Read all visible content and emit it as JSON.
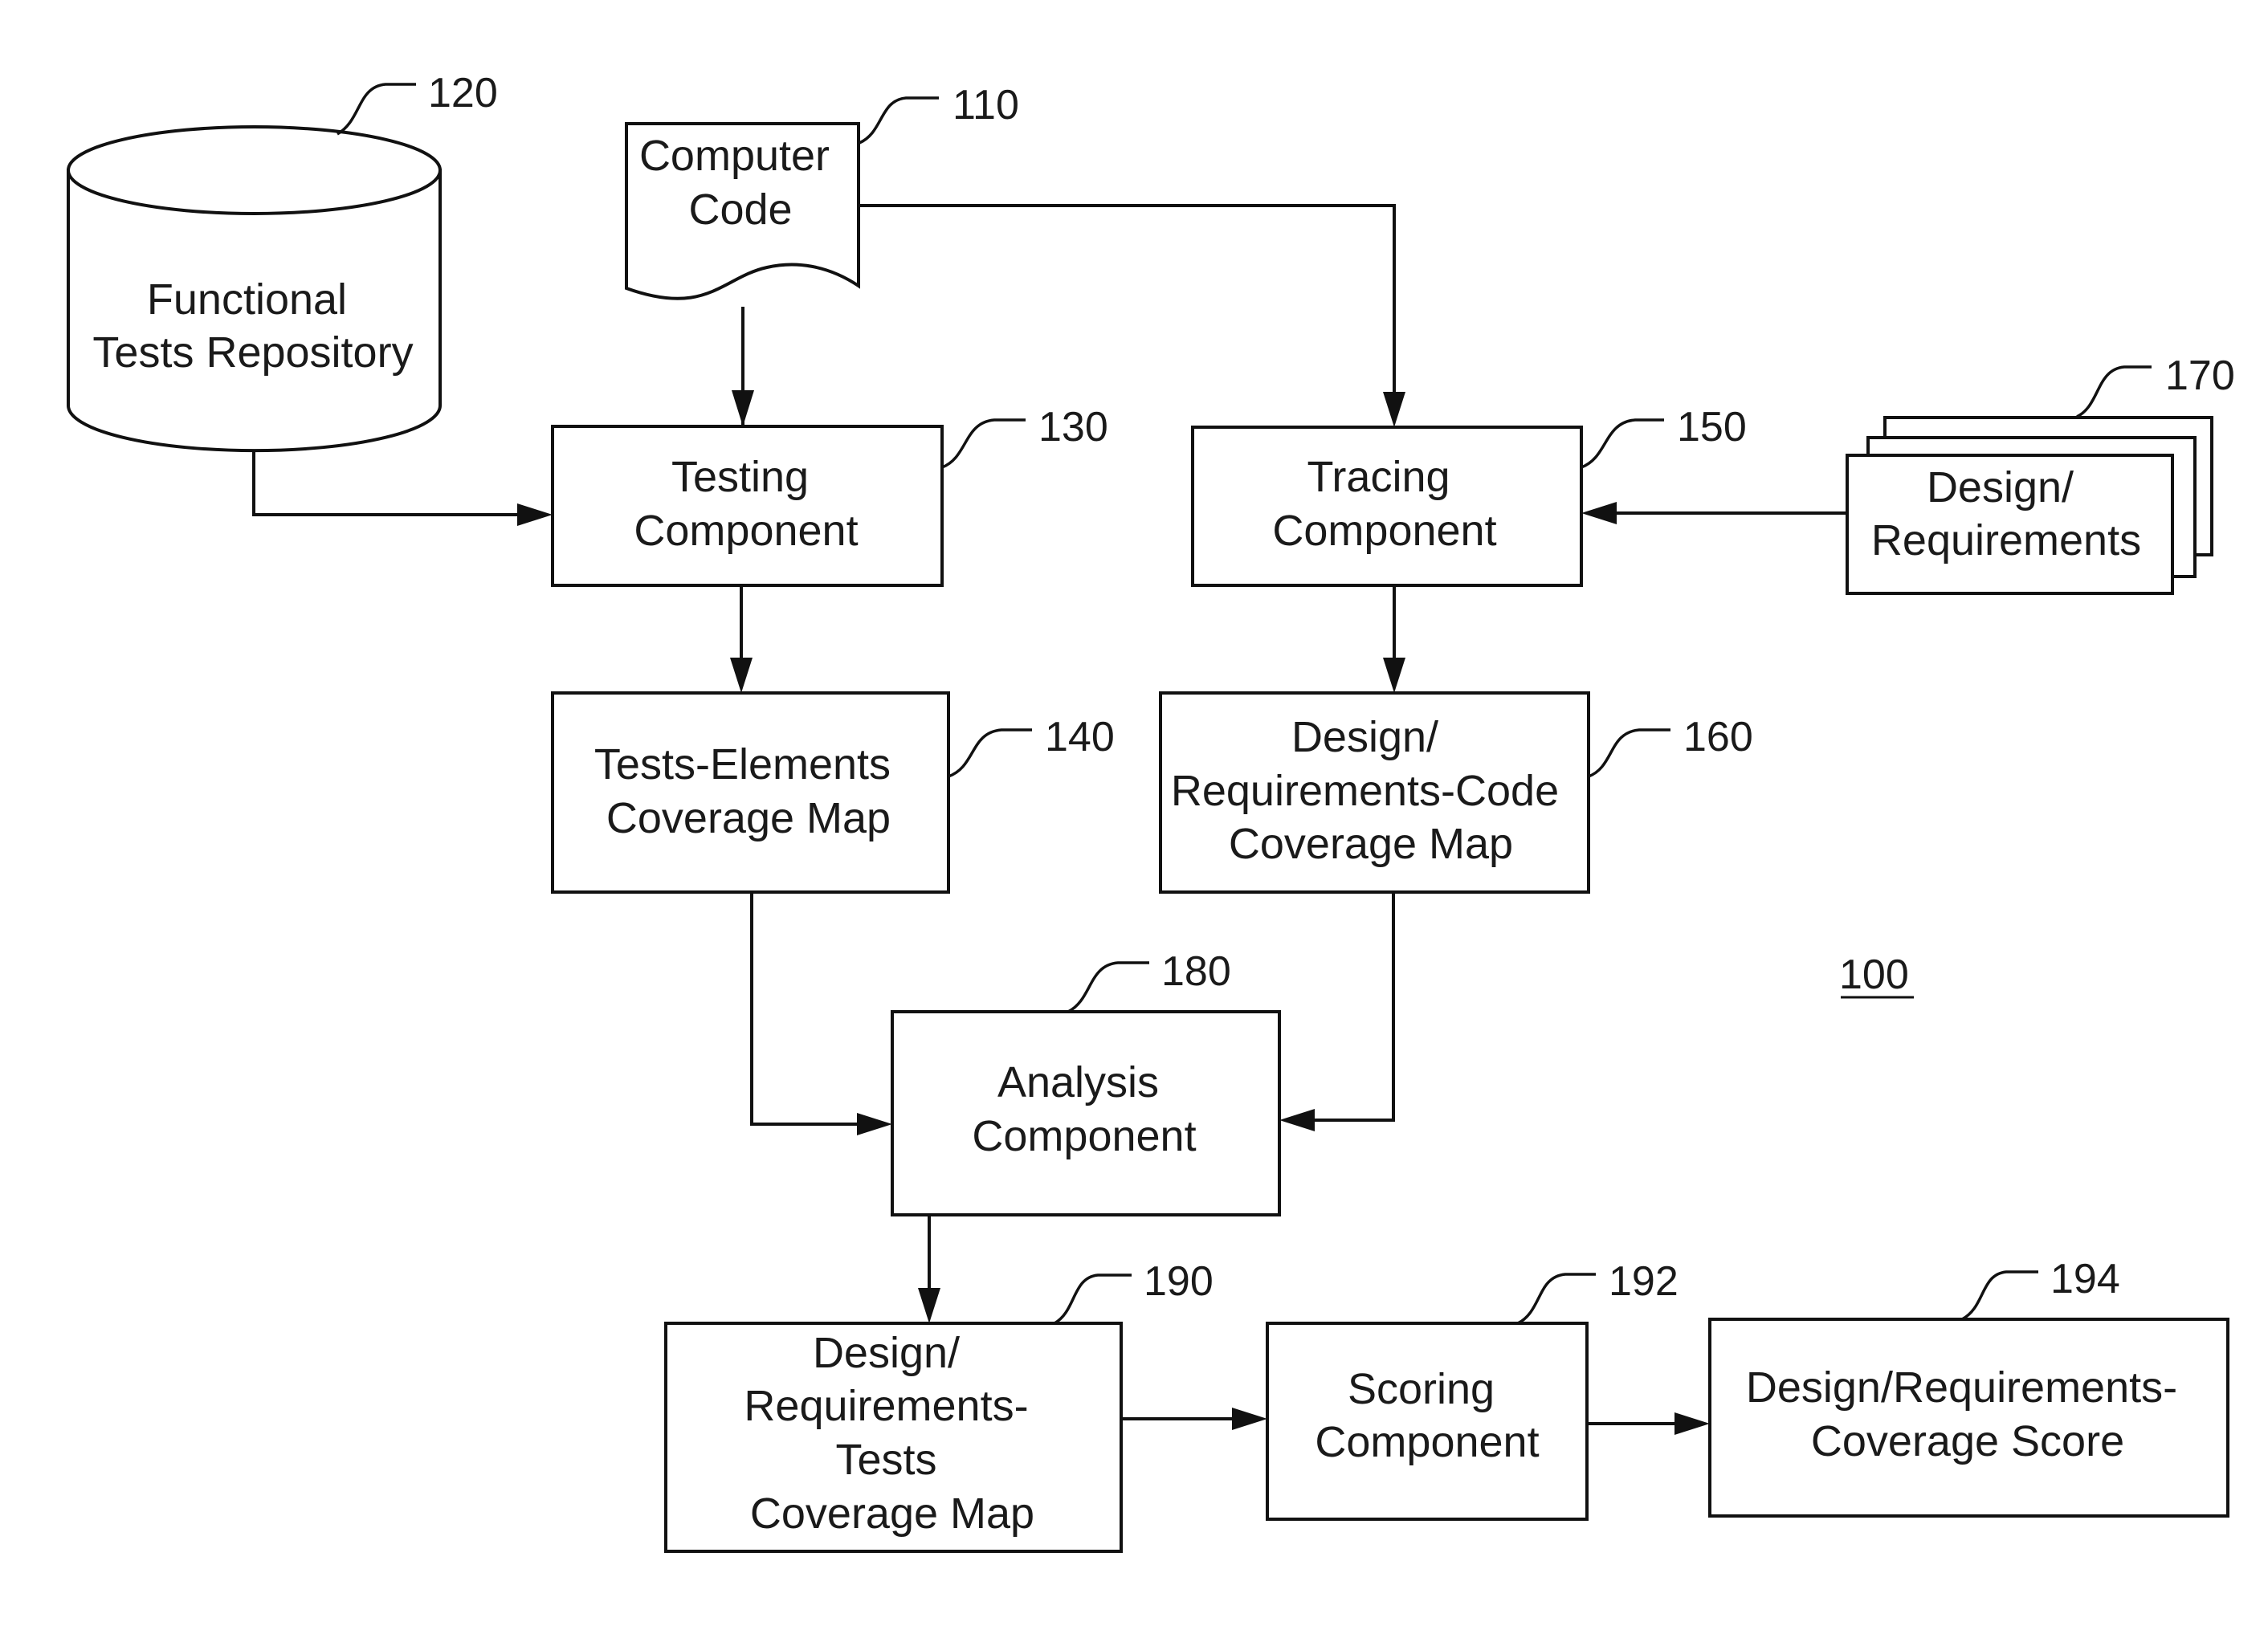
{
  "figure": {
    "reference": "100",
    "nodes": {
      "computer_code": {
        "ref": "110",
        "lines": [
          "Computer",
          "Code"
        ],
        "shape": "document"
      },
      "functional_tests_repository": {
        "ref": "120",
        "lines": [
          "Functional",
          "Tests Repository"
        ],
        "shape": "database"
      },
      "testing_component": {
        "ref": "130",
        "lines": [
          "Testing",
          "Component"
        ],
        "shape": "box"
      },
      "tests_elements_coverage_map": {
        "ref": "140",
        "lines": [
          "Tests-Elements",
          "Coverage Map"
        ],
        "shape": "box"
      },
      "tracing_component": {
        "ref": "150",
        "lines": [
          "Tracing",
          "Component"
        ],
        "shape": "box"
      },
      "design_requirements_code_coverage_map": {
        "ref": "160",
        "lines": [
          "Design/",
          "Requirements-Code",
          "Coverage Map"
        ],
        "shape": "box"
      },
      "design_requirements": {
        "ref": "170",
        "lines": [
          "Design/",
          "Requirements"
        ],
        "shape": "multi-document"
      },
      "analysis_component": {
        "ref": "180",
        "lines": [
          "Analysis",
          "Component"
        ],
        "shape": "box"
      },
      "design_requirements_tests_coverage_map": {
        "ref": "190",
        "lines": [
          "Design/",
          "Requirements-",
          "Tests",
          "Coverage Map"
        ],
        "shape": "box"
      },
      "scoring_component": {
        "ref": "192",
        "lines": [
          "Scoring",
          "Component"
        ],
        "shape": "box"
      },
      "design_requirements_coverage_score": {
        "ref": "194",
        "lines": [
          "Design/Requirements-",
          "Coverage Score"
        ],
        "shape": "box"
      }
    },
    "edges": [
      {
        "from": "110",
        "to": "130"
      },
      {
        "from": "110",
        "to": "150"
      },
      {
        "from": "120",
        "to": "130"
      },
      {
        "from": "170",
        "to": "150"
      },
      {
        "from": "130",
        "to": "140"
      },
      {
        "from": "150",
        "to": "160"
      },
      {
        "from": "140",
        "to": "180"
      },
      {
        "from": "160",
        "to": "180"
      },
      {
        "from": "180",
        "to": "190"
      },
      {
        "from": "190",
        "to": "192"
      },
      {
        "from": "192",
        "to": "194"
      }
    ]
  }
}
